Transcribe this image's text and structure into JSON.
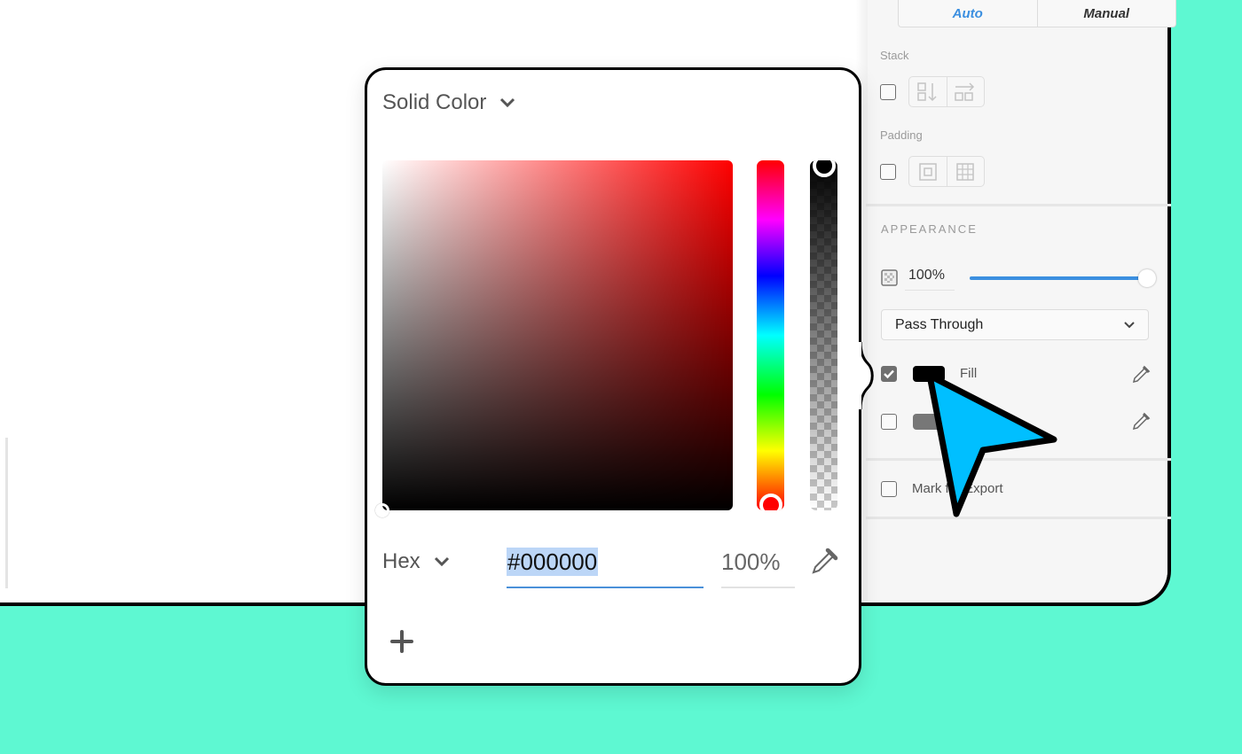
{
  "inspector": {
    "layout_modes": [
      {
        "label": "Auto",
        "active": true
      },
      {
        "label": "Manual",
        "active": false
      }
    ],
    "stack": {
      "label": "Stack",
      "checked": false,
      "icons": [
        "stack-vertical-icon",
        "stack-horizontal-icon"
      ]
    },
    "padding": {
      "label": "Padding",
      "checked": false,
      "icons": [
        "padding-uniform-icon",
        "padding-grid-icon"
      ]
    },
    "appearance": {
      "title": "APPEARANCE",
      "opacity_icon": "opacity-checker-icon",
      "opacity_value": "100%",
      "opacity_fraction": 1.0,
      "blend_mode": "Pass Through",
      "fills": [
        {
          "label": "Fill",
          "checked": true,
          "color": "#000000"
        },
        {
          "label": "",
          "checked": false,
          "color": "#777777"
        }
      ]
    },
    "export": {
      "label": "Mark for Export",
      "checked": false
    }
  },
  "color_picker": {
    "fill_type": "Solid Color",
    "hue_fraction": 0.0,
    "saturation": 0.0,
    "brightness": 0.0,
    "alpha_fraction": 1.0,
    "format": "Hex",
    "hex_value": "#000000",
    "alpha_value": "100%",
    "add_label": "+"
  },
  "colors": {
    "background": "#5ef8d2",
    "accent": "#3b8fe0",
    "cursor": "#00bfff"
  }
}
